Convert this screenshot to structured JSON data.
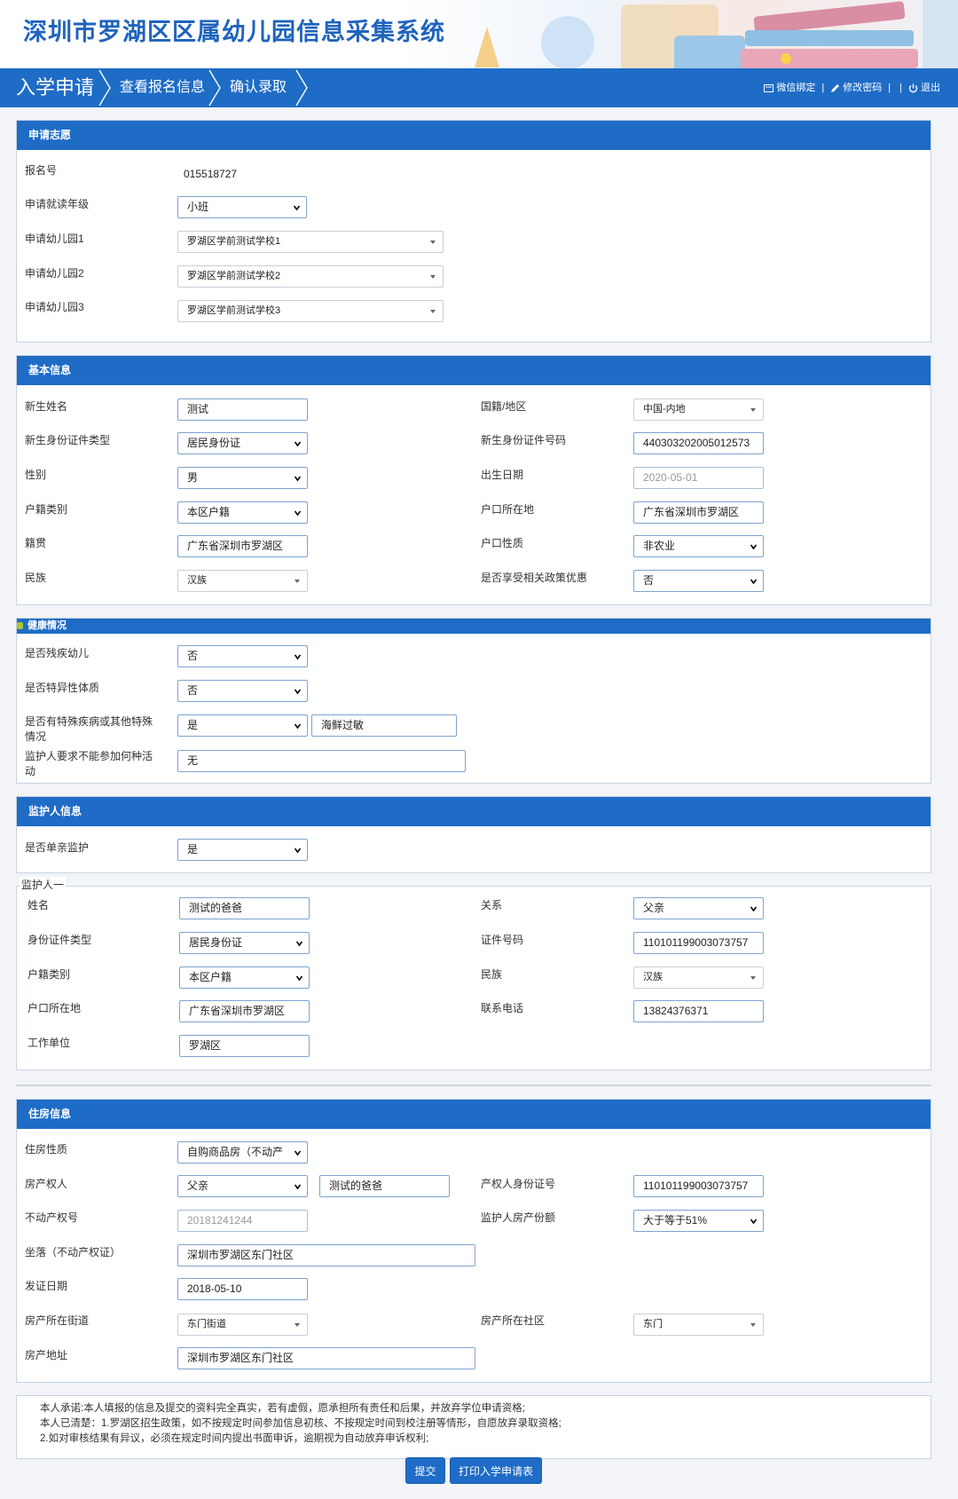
{
  "header": {
    "title": "深圳市罗湖区区属幼儿园信息采集系统"
  },
  "nav": {
    "items": [
      "入学申请",
      "查看报名信息",
      "确认录取"
    ],
    "wechat": "微信绑定",
    "change_password": "修改密码",
    "logout": "退出",
    "sep": "|"
  },
  "application": {
    "title": "申请志愿",
    "reg_no_label": "报名号",
    "reg_no": "015518727",
    "grade_label": "申请就读年级",
    "grade": "小班",
    "k1_label": "申请幼儿园1",
    "k1": "罗湖区学前测试学校1",
    "k2_label": "申请幼儿园2",
    "k2": "罗湖区学前测试学校2",
    "k3_label": "申请幼儿园3",
    "k3": "罗湖区学前测试学校3"
  },
  "basic": {
    "title": "基本信息",
    "name_label": "新生姓名",
    "name": "测试",
    "nationality_label": "国籍/地区",
    "nationality": "中国-内地",
    "id_type_label": "新生身份证件类型",
    "id_type": "居民身份证",
    "id_no_label": "新生身份证件号码",
    "id_no": "440303202005012573",
    "gender_label": "性别",
    "gender": "男",
    "birth_label": "出生日期",
    "birth": "2020-05-01",
    "hukou_type_label": "户籍类别",
    "hukou_type": "本区户籍",
    "hukou_loc_label": "户口所在地",
    "hukou_loc": "广东省深圳市罗湖区",
    "native_label": "籍贯",
    "native": "广东省深圳市罗湖区",
    "hukou_nature_label": "户口性质",
    "hukou_nature": "非农业",
    "ethnic_label": "民族",
    "ethnic": "汉族",
    "policy_label": "是否享受相关政策优惠",
    "policy": "否"
  },
  "health": {
    "title": "健康情况",
    "disabled_label": "是否残疾幼儿",
    "disabled": "否",
    "allergy_label": "是否特异性体质",
    "allergy": "否",
    "special_label": "是否有特殊疾病或其他特殊情况",
    "special": "是",
    "special_note": "海鲜过敏",
    "activity_label": "监护人要求不能参加何种活动",
    "activity": "无"
  },
  "guardian": {
    "title": "监护人信息",
    "single_label": "是否单亲监护",
    "single": "是",
    "legend": "监护人一",
    "name_label": "姓名",
    "name": "测试的爸爸",
    "relation_label": "关系",
    "relation": "父亲",
    "id_type_label": "身份证件类型",
    "id_type": "居民身份证",
    "id_no_label": "证件号码",
    "id_no": "110101199003073757",
    "hukou_type_label": "户籍类别",
    "hukou_type": "本区户籍",
    "ethnic_label": "民族",
    "ethnic": "汉族",
    "hukou_loc_label": "户口所在地",
    "hukou_loc": "广东省深圳市罗湖区",
    "phone_label": "联系电话",
    "phone": "13824376371",
    "work_label": "工作单位",
    "work": "罗湖区"
  },
  "housing": {
    "title": "住房信息",
    "nature_label": "住房性质",
    "nature": "自购商品房（不动产",
    "owner_label": "房产权人",
    "owner_rel": "父亲",
    "owner_name": "测试的爸爸",
    "owner_id_label": "产权人身份证号",
    "owner_id": "110101199003073757",
    "cert_label": "不动产权号",
    "cert": "20181241244",
    "share_label": "监护人房产份额",
    "share": "大于等于51%",
    "location_label": "坐落（不动产权证）",
    "location": "深圳市罗湖区东门社区",
    "issue_label": "发证日期",
    "issue": "2018-05-10",
    "street_label": "房产所在街道",
    "street": "东门街道",
    "community_label": "房产所在社区",
    "community": "东门",
    "address_label": "房产地址",
    "address": "深圳市罗湖区东门社区"
  },
  "notice": {
    "line1": "本人承诺:本人填报的信息及提交的资料完全真实，若有虚假，愿承担所有责任和后果，并放弃学位申请资格;",
    "line2": "本人已清楚：1.罗湖区招生政策，如不按规定时间参加信息初核、不按规定时间到校注册等情形，自愿放弃录取资格;",
    "line3": "2.如对审核结果有异议，必须在规定时间内提出书面申诉，逾期视为自动放弃申诉权利;"
  },
  "buttons": {
    "submit": "提交",
    "print": "打印入学申请表"
  },
  "colors": {
    "primary": "#1e6cc6",
    "title": "#1f63bd"
  }
}
